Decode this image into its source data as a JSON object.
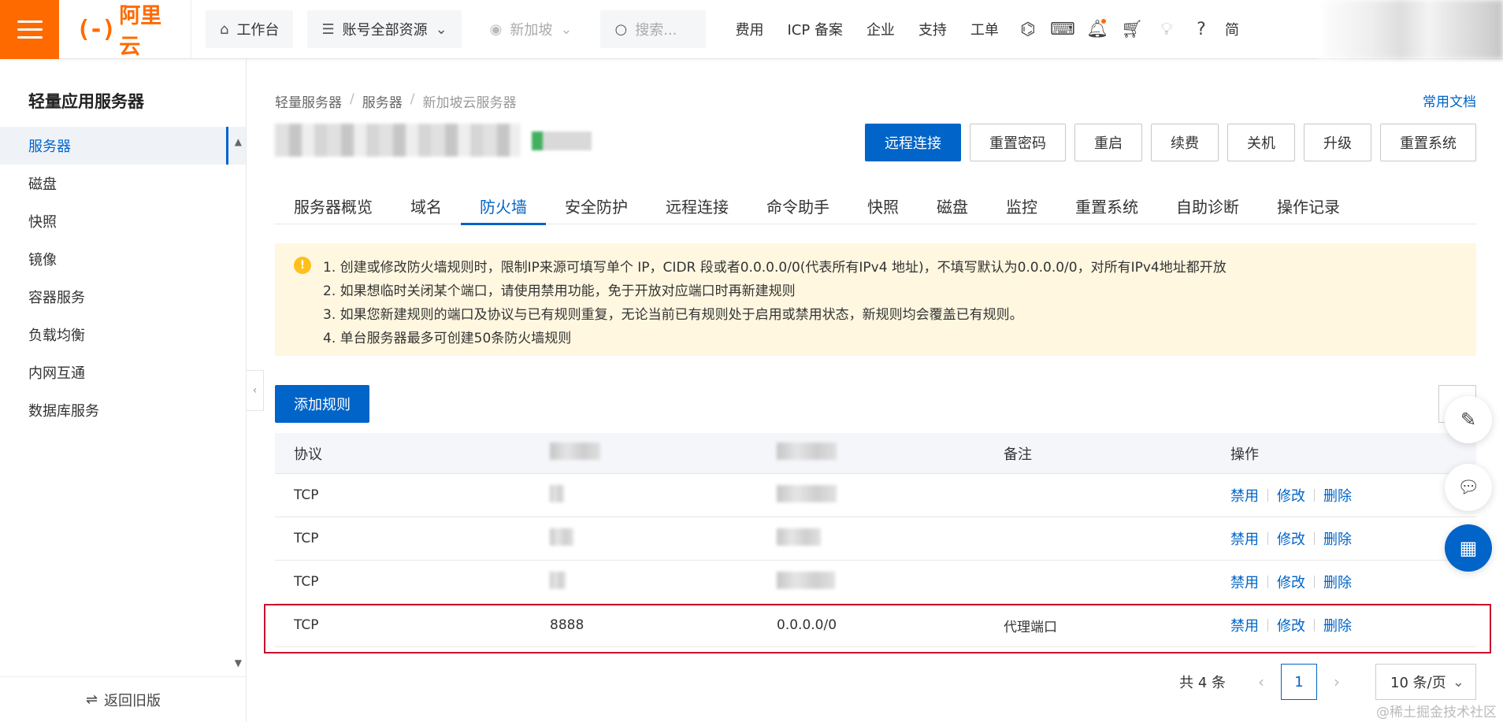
{
  "topbar": {
    "logo_mark": "(-)",
    "logo_text": "阿里云",
    "workbench": "工作台",
    "resources": "账号全部资源",
    "region": "新加坡",
    "search_placeholder": "搜索...",
    "links": [
      "费用",
      "ICP 备案",
      "企业",
      "支持",
      "工单"
    ],
    "lang": "简"
  },
  "sidebar": {
    "title": "轻量应用服务器",
    "items": [
      "服务器",
      "磁盘",
      "快照",
      "镜像",
      "容器服务",
      "负载均衡",
      "内网互通",
      "数据库服务"
    ],
    "footer": "返回旧版",
    "footer_icon": "⇌"
  },
  "breadcrumb": [
    "轻量服务器",
    "服务器",
    "新加坡云服务器"
  ],
  "doc_link": "常用文档",
  "actions": [
    "远程连接",
    "重置密码",
    "重启",
    "续费",
    "关机",
    "升级",
    "重置系统"
  ],
  "tabs": [
    "服务器概览",
    "域名",
    "防火墙",
    "安全防护",
    "远程连接",
    "命令助手",
    "快照",
    "磁盘",
    "监控",
    "重置系统",
    "自助诊断",
    "操作记录"
  ],
  "notice": {
    "icon": "!",
    "lines": [
      "1. 创建或修改防火墙规则时，限制IP来源可填写单个 IP，CIDR 段或者0.0.0.0/0(代表所有IPv4 地址)，不填写默认为0.0.0.0/0，对所有IPv4地址都开放",
      "2. 如果想临时关闭某个端口，请使用禁用功能，免于开放对应端口时再新建规则",
      "3. 如果您新建规则的端口及协议与已有规则重复，无论当前已有规则处于启用或禁用状态，新规则均会覆盖已有规则。",
      "4. 单台服务器最多可创建50条防火墙规则"
    ]
  },
  "add_rule": "添加规则",
  "table": {
    "headers": {
      "protocol": "协议",
      "remark": "备注",
      "ops": "操作"
    },
    "rows": [
      {
        "protocol": "TCP",
        "port": "",
        "source": "",
        "remark": ""
      },
      {
        "protocol": "TCP",
        "port": "",
        "source": "",
        "remark": ""
      },
      {
        "protocol": "TCP",
        "port": "",
        "source": "",
        "remark": ""
      },
      {
        "protocol": "TCP",
        "port": "8888",
        "source": "0.0.0.0/0",
        "remark": "代理端口"
      }
    ],
    "ops": {
      "disable": "禁用",
      "edit": "修改",
      "delete": "删除"
    }
  },
  "pager": {
    "total": "共 4 条",
    "current": "1",
    "page_size": "10 条/页"
  },
  "watermark": "@稀土掘金技术社区",
  "colors": {
    "brand_orange": "#ff6a00",
    "primary_blue": "#0064c8",
    "notice_bg": "#fff7e0",
    "highlight_red": "#c8102e"
  }
}
